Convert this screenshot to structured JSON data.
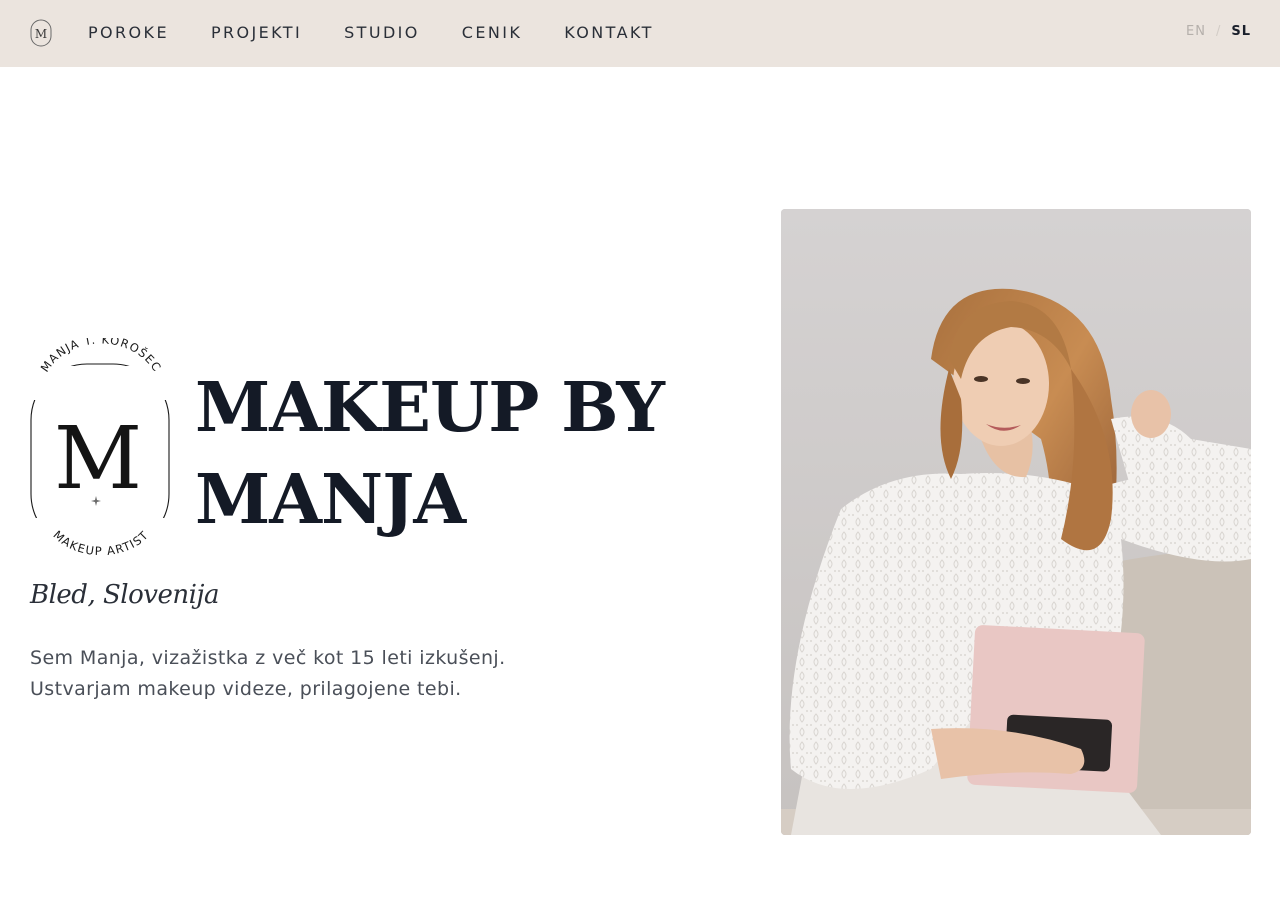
{
  "nav": {
    "logo_letters": "M",
    "items": [
      {
        "label": "POROKE"
      },
      {
        "label": "PROJEKTI"
      },
      {
        "label": "STUDIO"
      },
      {
        "label": "CENIK"
      },
      {
        "label": "KONTAKT"
      }
    ],
    "lang": {
      "en": "EN",
      "separator": "/",
      "sl": "SL"
    }
  },
  "hero": {
    "emblem": {
      "top_text": "MANJA T. KOROŠEC",
      "monogram": "M",
      "bottom_text": "MAKEUP ARTIST"
    },
    "title_lines": [
      "MAKEUP BY",
      "MANJA"
    ],
    "location": "Bled, Slovenija",
    "intro_lines": [
      "Sem Manja, vizažistka z več kot 15 leti izkušenj.",
      "Ustvarjam makeup videze, prilagojene tebi."
    ]
  },
  "colors": {
    "header_bg": "#ebe4de",
    "text_dark": "#141a26",
    "text_muted": "#4a4f58",
    "lang_inactive": "#b5b0ab"
  },
  "icons": {
    "logo": "monogram-m-oval-icon",
    "emblem": "monogram-emblem-icon"
  }
}
